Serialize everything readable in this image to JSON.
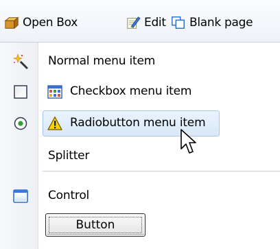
{
  "toolbar": {
    "open_box_label": "Open Box",
    "edit_label": "Edit",
    "blank_page_label": "Blank page"
  },
  "menu": {
    "items": [
      {
        "label": "Normal menu item",
        "gutter_icon": "magic-wand-icon"
      },
      {
        "label": "Checkbox menu item",
        "gutter_icon": "checkbox-icon",
        "content_icon": "grid-table-icon",
        "checked": false
      },
      {
        "label": "Radiobutton menu item",
        "gutter_icon": "radio-icon",
        "content_icon": "warning-icon",
        "selected": true,
        "highlighted": true
      },
      {
        "label": "Splitter"
      },
      {
        "label": "Control",
        "gutter_icon": "window-icon"
      }
    ],
    "button_label": "Button"
  },
  "colors": {
    "highlight_fill": "#dce9f8",
    "highlight_border": "#a8c6ea",
    "toolbar_bg": "#f0f4fa",
    "accent_blue": "#3a74c8"
  }
}
